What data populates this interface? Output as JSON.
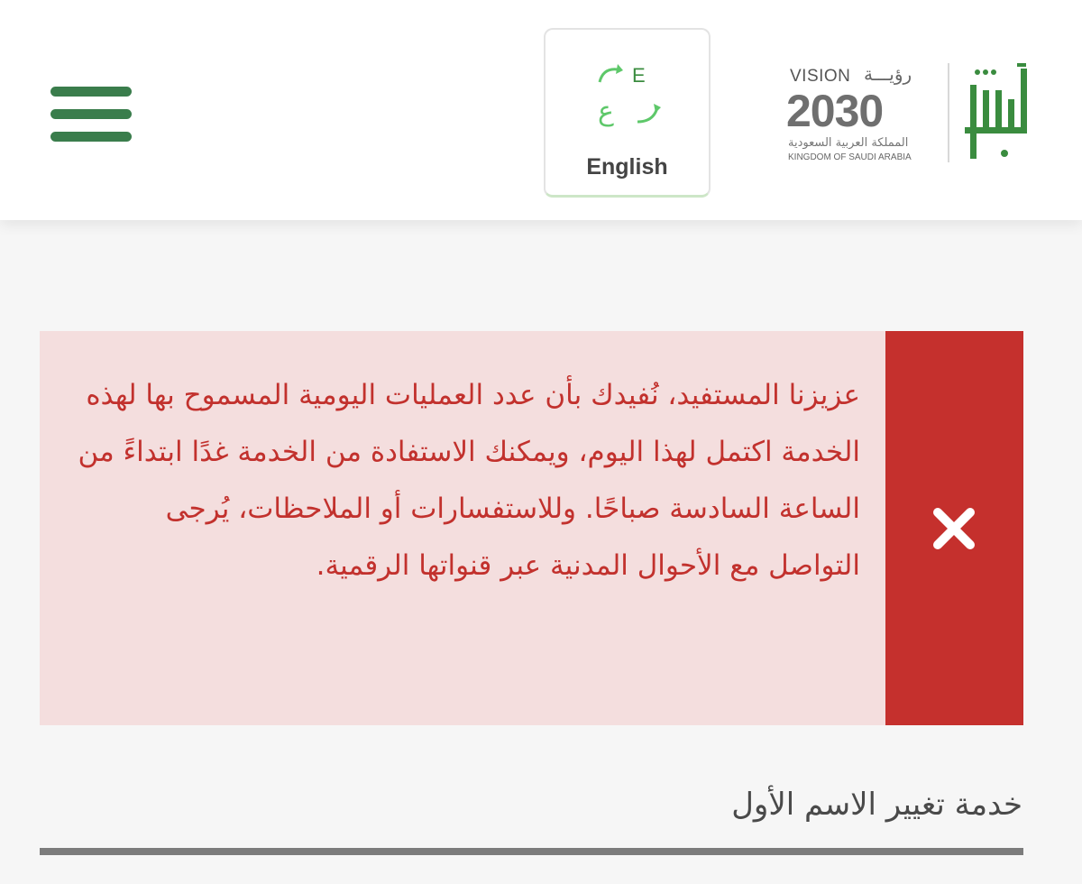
{
  "header": {
    "language_button_label": "English",
    "vision_logo": {
      "title_en": "VISION",
      "title_ar": "رؤيـــة",
      "year": "2030",
      "subtitle_ar": "المملكة العربية السعودية",
      "subtitle_en": "KINGDOM OF SAUDI ARABIA"
    },
    "brand_logo_text": "أبشر",
    "brand_color": "#3a8c3f"
  },
  "alert": {
    "message": "عزيزنا المستفيد، نُفيدك بأن عدد العمليات اليومية المسموح بها لهذه الخدمة اكتمل لهذا اليوم، ويمكنك الاستفادة من الخدمة غدًا ابتداءً من الساعة السادسة صباحًا. وللاستفسارات أو الملاحظات، يُرجى التواصل مع الأحوال المدنية عبر قنواتها الرقمية.",
    "icon": "close-icon",
    "background_color": "#f4dede",
    "accent_color": "#c5302d",
    "text_color": "#c2312d"
  },
  "service": {
    "title": "خدمة تغيير الاسم الأول"
  }
}
